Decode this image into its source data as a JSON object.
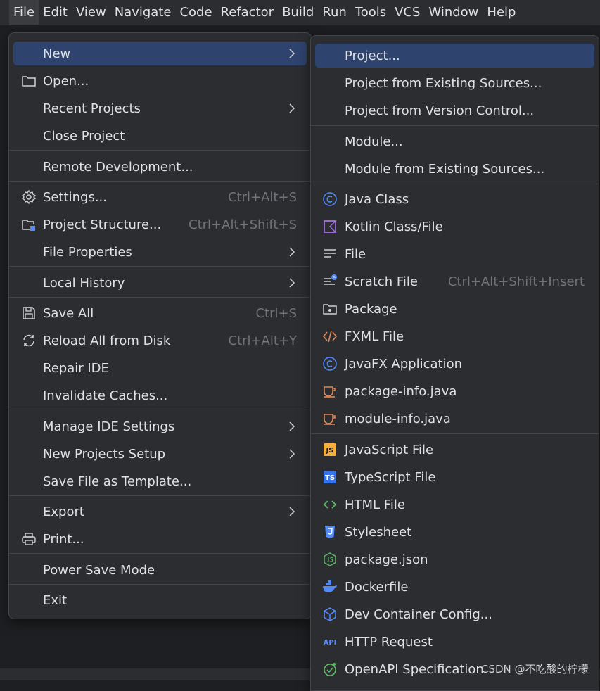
{
  "menubar": {
    "items": [
      "File",
      "Edit",
      "View",
      "Navigate",
      "Code",
      "Refactor",
      "Build",
      "Run",
      "Tools",
      "VCS",
      "Window",
      "Help"
    ]
  },
  "file_menu": {
    "new": "New",
    "open": "Open...",
    "recent_projects": "Recent Projects",
    "close_project": "Close Project",
    "remote_development": "Remote Development...",
    "settings": "Settings...",
    "settings_shortcut": "Ctrl+Alt+S",
    "project_structure": "Project Structure...",
    "project_structure_shortcut": "Ctrl+Alt+Shift+S",
    "file_properties": "File Properties",
    "local_history": "Local History",
    "save_all": "Save All",
    "save_all_shortcut": "Ctrl+S",
    "reload_all": "Reload All from Disk",
    "reload_all_shortcut": "Ctrl+Alt+Y",
    "repair_ide": "Repair IDE",
    "invalidate_caches": "Invalidate Caches...",
    "manage_ide_settings": "Manage IDE Settings",
    "new_projects_setup": "New Projects Setup",
    "save_as_template": "Save File as Template...",
    "export": "Export",
    "print": "Print...",
    "power_save": "Power Save Mode",
    "exit": "Exit"
  },
  "new_menu": {
    "project": "Project...",
    "project_existing": "Project from Existing Sources...",
    "project_vcs": "Project from Version Control...",
    "module": "Module...",
    "module_existing": "Module from Existing Sources...",
    "java_class": "Java Class",
    "kotlin_class": "Kotlin Class/File",
    "file": "File",
    "scratch_file": "Scratch File",
    "scratch_shortcut": "Ctrl+Alt+Shift+Insert",
    "package": "Package",
    "fxml_file": "FXML File",
    "javafx_app": "JavaFX Application",
    "package_info": "package-info.java",
    "module_info": "module-info.java",
    "javascript_file": "JavaScript File",
    "typescript_file": "TypeScript File",
    "html_file": "HTML File",
    "stylesheet": "Stylesheet",
    "package_json": "package.json",
    "dockerfile": "Dockerfile",
    "dev_container": "Dev Container Config...",
    "http_request": "HTTP Request",
    "openapi": "OpenAPI Specification"
  },
  "icons": {
    "js_badge": "JS",
    "ts_badge": "TS",
    "api_badge": "API"
  },
  "watermark": "CSDN @不吃酸的柠檬",
  "colors": {
    "accent_selection": "#2e436e",
    "java_blue": "#548af7",
    "kotlin_purple": "#a571e6",
    "orange": "#e08855",
    "js_yellow": "#f4af3d",
    "ts_blue": "#3574f0",
    "green": "#5fb865"
  }
}
